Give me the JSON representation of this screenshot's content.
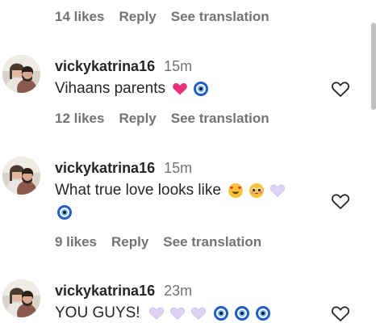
{
  "top_meta": {
    "likes": "14 likes",
    "reply": "Reply",
    "translate": "See translation"
  },
  "comments": [
    {
      "username": "vickykatrina16",
      "time": "15m",
      "text": "Vihaans parents",
      "emojis": [
        "pink-heart-emoji",
        "nazar-amulet-emoji"
      ],
      "likes": "12 likes",
      "reply": "Reply",
      "translate": "See translation"
    },
    {
      "username": "vickykatrina16",
      "time": "15m",
      "text": "What true love looks like",
      "emojis": [
        "heart-eyes-emoji",
        "pleading-face-emoji",
        "light-purple-heart-emoji",
        "nazar-amulet-emoji"
      ],
      "likes": "9 likes",
      "reply": "Reply",
      "translate": "See translation"
    },
    {
      "username": "vickykatrina16",
      "time": "23m",
      "text": "YOU GUYS!",
      "emojis": [
        "light-purple-heart-emoji",
        "light-purple-heart-emoji",
        "light-purple-heart-emoji",
        "nazar-amulet-emoji",
        "nazar-amulet-emoji",
        "nazar-amulet-emoji"
      ]
    }
  ],
  "colors": {
    "text": "#262626",
    "muted": "#737373",
    "pink_heart": "#e8317a",
    "light_purple_heart": "#d9d0f2",
    "nazar_blue": "#1f5fc4"
  }
}
